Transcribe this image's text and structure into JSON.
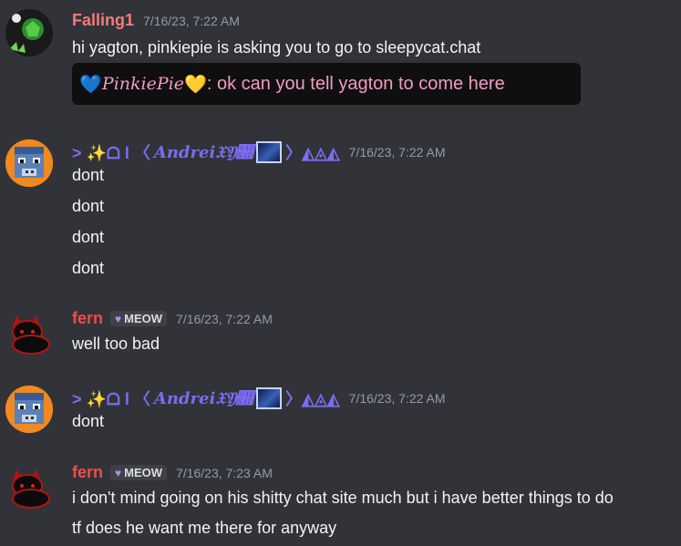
{
  "messages": [
    {
      "author": "Falling1",
      "author_color": "#f47b7b",
      "timestamp": "7/16/23, 7:22 AM",
      "lines": [
        "hi yagton, pinkiepie is asking you to go to sleepycat.chat"
      ],
      "embed": {
        "heart_left": "💙",
        "name": "PinkiePie",
        "heart_right": "💛",
        "text": ": ok can you tell yagton to come here"
      }
    },
    {
      "author_prefix": "> ✨ᗝ l 〈",
      "author_main": "Andrei𝔛𝔜𝔝",
      "author_suffix": "〉◭◬◭",
      "author_color": "#7b6df0",
      "timestamp": "7/16/23, 7:22 AM",
      "lines": [
        "dont",
        "dont",
        "dont",
        "dont"
      ]
    },
    {
      "author": "fern",
      "author_color": "#f04c4c",
      "tag": "MEOW",
      "timestamp": "7/16/23, 7:22 AM",
      "lines": [
        "well too bad"
      ]
    },
    {
      "author_prefix": "> ✨ᗝ l 〈",
      "author_main": "Andrei𝔛𝔜𝔝",
      "author_suffix": "〉◭◬◭",
      "author_color": "#7b6df0",
      "timestamp": "7/16/23, 7:22 AM",
      "lines": [
        "dont"
      ]
    },
    {
      "author": "fern",
      "author_color": "#f04c4c",
      "tag": "MEOW",
      "timestamp": "7/16/23, 7:23 AM",
      "lines": [
        "i don't mind going on his shitty chat site much but i have better things to do",
        "tf does he want me there for anyway"
      ]
    }
  ]
}
